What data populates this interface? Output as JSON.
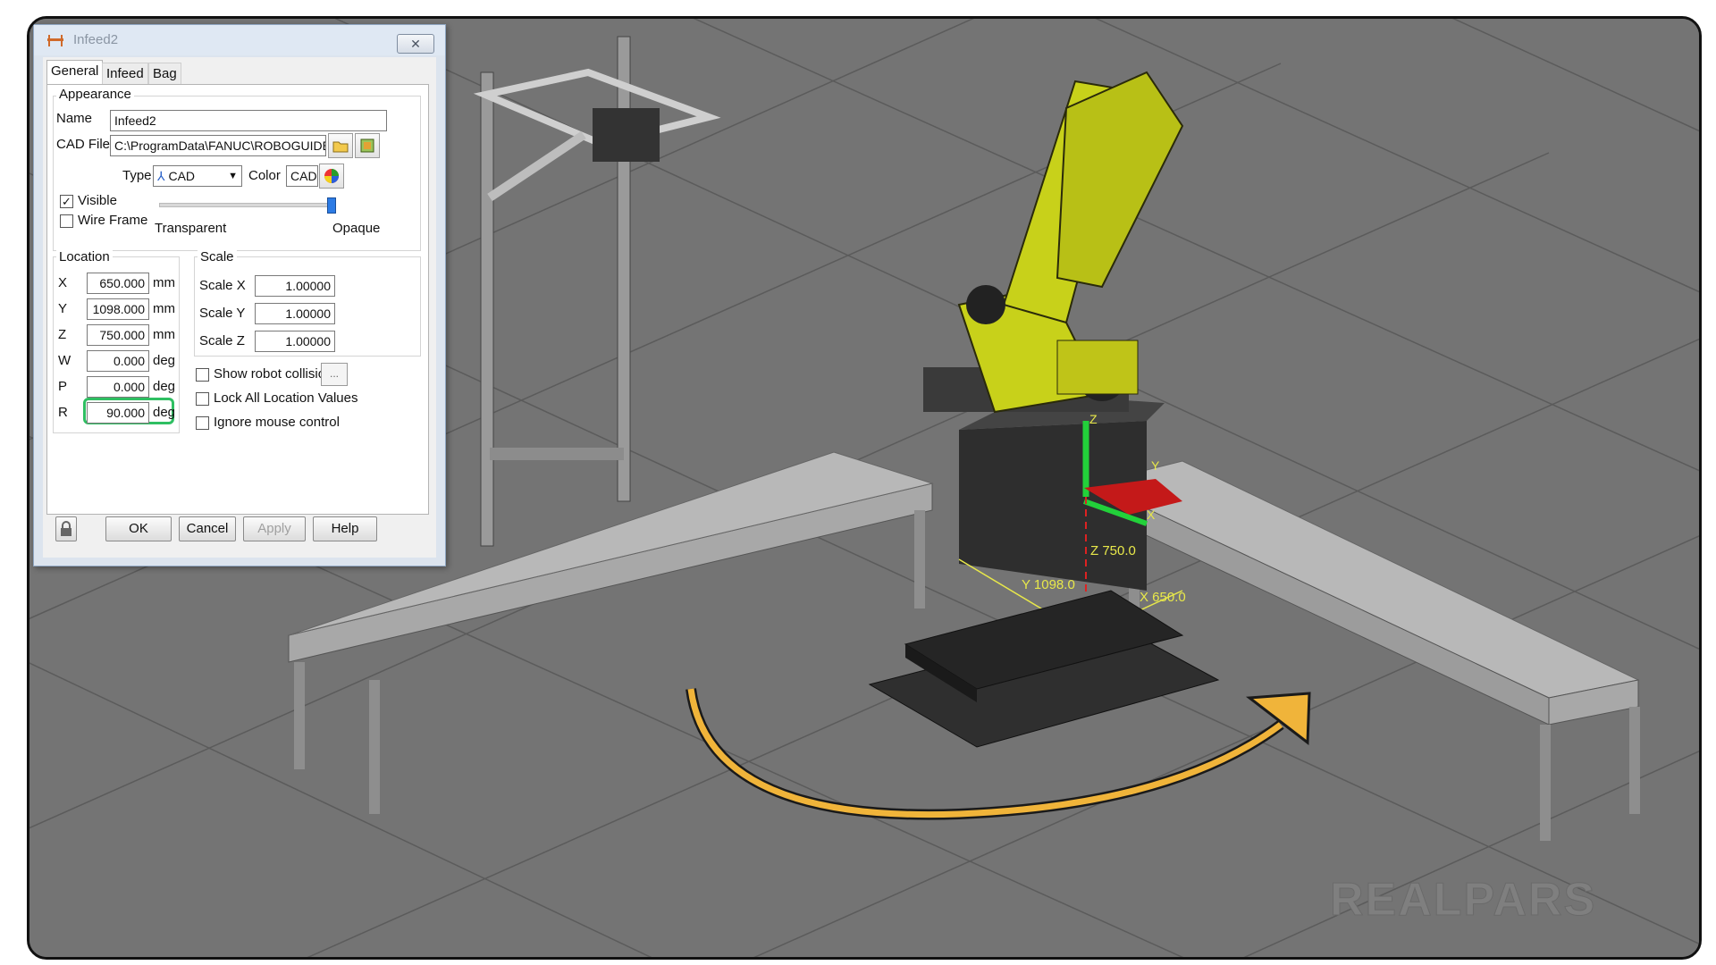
{
  "dialog": {
    "title": "Infeed2",
    "close_glyph": "✕",
    "tabs": [
      "General",
      "Infeed",
      "Bag"
    ],
    "appearance": {
      "group_label": "Appearance",
      "name_label": "Name",
      "name_value": "Infeed2",
      "cad_label": "CAD File",
      "cad_value": "C:\\ProgramData\\FANUC\\ROBOGUIDE",
      "type_label": "Type",
      "type_value": "CAD",
      "color_label": "Color",
      "color_value": "CAD",
      "visible_label": "Visible",
      "visible_checked": true,
      "wireframe_label": "Wire Frame",
      "wireframe_checked": false,
      "transparent_label": "Transparent",
      "opaque_label": "Opaque",
      "opacity_percent": 100
    },
    "location": {
      "group_label": "Location",
      "rows": [
        {
          "axis": "X",
          "value": "650.000",
          "unit": "mm"
        },
        {
          "axis": "Y",
          "value": "1098.000",
          "unit": "mm"
        },
        {
          "axis": "Z",
          "value": "750.000",
          "unit": "mm"
        },
        {
          "axis": "W",
          "value": "0.000",
          "unit": "deg"
        },
        {
          "axis": "P",
          "value": "0.000",
          "unit": "deg"
        },
        {
          "axis": "R",
          "value": "90.000",
          "unit": "deg"
        }
      ]
    },
    "scale": {
      "group_label": "Scale",
      "rows": [
        {
          "label": "Scale X",
          "value": "1.00000"
        },
        {
          "label": "Scale Y",
          "value": "1.00000"
        },
        {
          "label": "Scale Z",
          "value": "1.00000"
        }
      ]
    },
    "options": [
      {
        "label": "Show robot collisions",
        "checked": false
      },
      {
        "label": "Lock All Location Values",
        "checked": false
      },
      {
        "label": "Ignore mouse control",
        "checked": false
      }
    ],
    "more_button": "...",
    "buttons": {
      "ok": "OK",
      "cancel": "Cancel",
      "apply": "Apply",
      "help": "Help"
    }
  },
  "scene": {
    "axis_labels": {
      "z_axis": "Z",
      "y_axis": "Y",
      "x_axis": "X"
    },
    "dimension_labels": {
      "z": "Z 750.0",
      "y": "Y 1098.0",
      "x": "X 650.0"
    },
    "watermark": "REALPARS",
    "colors": {
      "floor": "#747474",
      "robot": "#c8d11a",
      "highlight": "#22d13a",
      "arrow": "#f0b43a",
      "conveyor": "#a8a8a8"
    }
  }
}
